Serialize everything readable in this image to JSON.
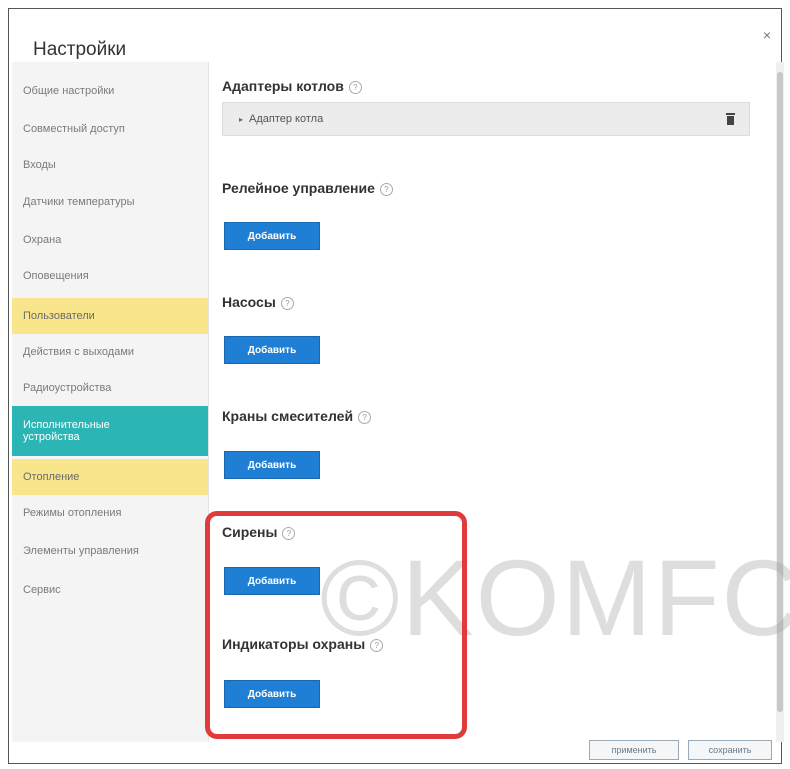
{
  "window": {
    "title": "Настройки",
    "close": "×"
  },
  "sidebar": {
    "items": [
      {
        "label": "Общие настройки",
        "state": "normal"
      },
      {
        "label": "Совместный доступ",
        "state": "normal"
      },
      {
        "label": "Входы",
        "state": "normal"
      },
      {
        "label": "Датчики температуры",
        "state": "normal"
      },
      {
        "label": "Охрана",
        "state": "normal"
      },
      {
        "label": "Оповещения",
        "state": "normal"
      },
      {
        "label": "Пользователи",
        "state": "highlighted"
      },
      {
        "label": "Действия с выходами",
        "state": "normal"
      },
      {
        "label": "Радиоустройства",
        "state": "normal"
      },
      {
        "label": "Исполнительные устройства",
        "state": "selected"
      },
      {
        "label": "Отопление",
        "state": "highlighted"
      },
      {
        "label": "Режимы отопления",
        "state": "normal"
      },
      {
        "label": "Элементы управления",
        "state": "normal"
      },
      {
        "label": "Сервис",
        "state": "normal"
      }
    ]
  },
  "main": {
    "help_icon": "?",
    "boiler_adapters": {
      "title": "Адаптеры котлов",
      "item_label": "Адаптер котла",
      "caret": "▸"
    },
    "relay": {
      "title": "Релейное управление",
      "add_label": "Добавить"
    },
    "pumps": {
      "title": "Насосы",
      "add_label": "Добавить"
    },
    "mixers": {
      "title": "Краны смесителей",
      "add_label": "Добавить"
    },
    "sirens": {
      "title": "Сирены",
      "add_label": "Добавить"
    },
    "security_indicators": {
      "title": "Индикаторы охраны",
      "add_label": "Добавить"
    }
  },
  "footer": {
    "apply_label": "применить",
    "save_label": "сохранить"
  },
  "watermark": "©KOMFC",
  "colors": {
    "accent_blue": "#1f7fd4",
    "selected_teal": "#2cb5b5",
    "highlight_yellow": "#f8e58c",
    "annotation_red": "#e03a3a"
  }
}
